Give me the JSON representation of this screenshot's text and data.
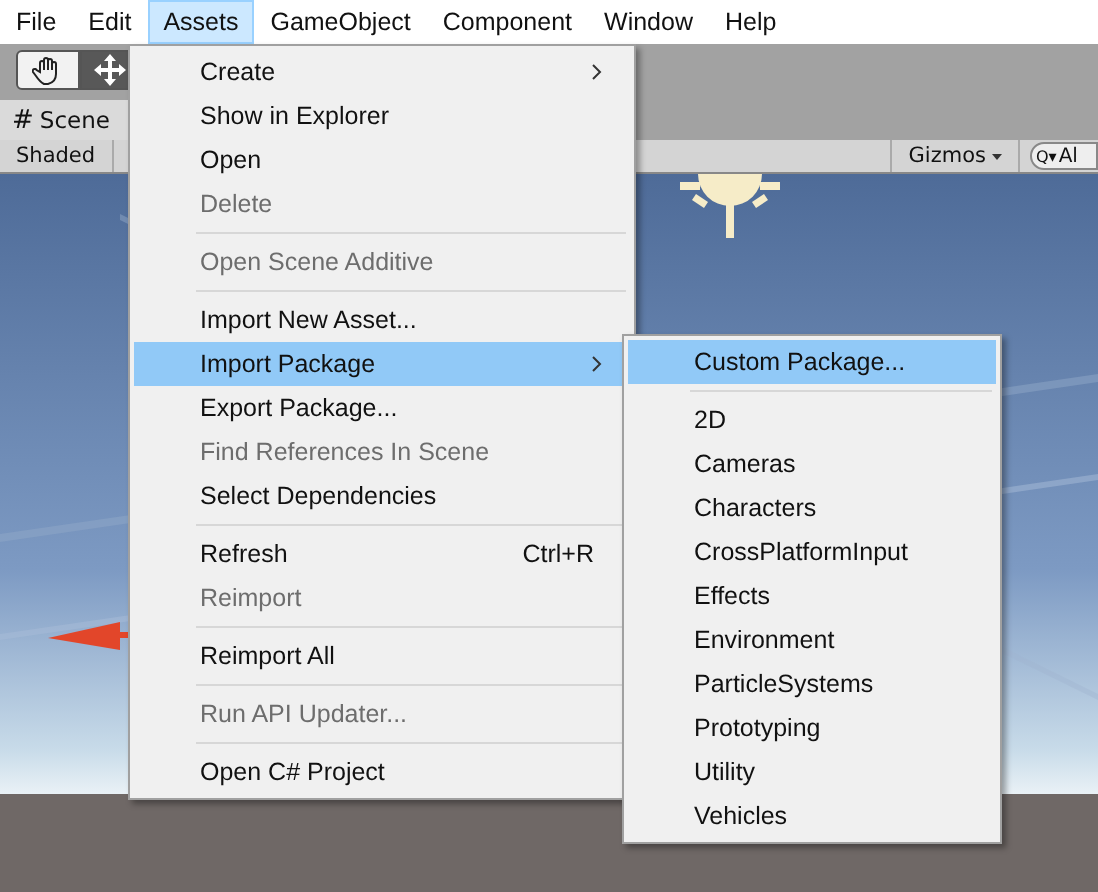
{
  "menu_bar": [
    {
      "label": "File",
      "selected": false
    },
    {
      "label": "Edit",
      "selected": false
    },
    {
      "label": "Assets",
      "selected": true
    },
    {
      "label": "GameObject",
      "selected": false
    },
    {
      "label": "Component",
      "selected": false
    },
    {
      "label": "Window",
      "selected": false
    },
    {
      "label": "Help",
      "selected": false
    }
  ],
  "toolbar": {
    "tools": [
      {
        "kind": "hand",
        "selected": true
      },
      {
        "kind": "move",
        "selected": false
      }
    ]
  },
  "scene_tab": {
    "icon": "#",
    "label": "Scene"
  },
  "scene_bar": {
    "draw_mode": "Shaded",
    "gizmos": "Gizmos",
    "search_icon": "Q▾",
    "search_placeholder": "Al"
  },
  "assets_menu": {
    "items": [
      {
        "kind": "item",
        "label": "Create",
        "disabled": false,
        "selected": false,
        "submenu": true
      },
      {
        "kind": "item",
        "label": "Show in Explorer",
        "disabled": false,
        "selected": false
      },
      {
        "kind": "item",
        "label": "Open",
        "disabled": false,
        "selected": false
      },
      {
        "kind": "item",
        "label": "Delete",
        "disabled": true,
        "selected": false
      },
      {
        "kind": "separator"
      },
      {
        "kind": "item",
        "label": "Open Scene Additive",
        "disabled": true,
        "selected": false
      },
      {
        "kind": "separator"
      },
      {
        "kind": "item",
        "label": "Import New Asset...",
        "disabled": false,
        "selected": false
      },
      {
        "kind": "item",
        "label": "Import Package",
        "disabled": false,
        "selected": true,
        "submenu": true
      },
      {
        "kind": "item",
        "label": "Export Package...",
        "disabled": false,
        "selected": false
      },
      {
        "kind": "item",
        "label": "Find References In Scene",
        "disabled": true,
        "selected": false
      },
      {
        "kind": "item",
        "label": "Select Dependencies",
        "disabled": false,
        "selected": false
      },
      {
        "kind": "separator"
      },
      {
        "kind": "item",
        "label": "Refresh",
        "disabled": false,
        "selected": false,
        "shortcut": "Ctrl+R"
      },
      {
        "kind": "item",
        "label": "Reimport",
        "disabled": true,
        "selected": false
      },
      {
        "kind": "separator"
      },
      {
        "kind": "item",
        "label": "Reimport All",
        "disabled": false,
        "selected": false
      },
      {
        "kind": "separator"
      },
      {
        "kind": "item",
        "label": "Run API Updater...",
        "disabled": true,
        "selected": false
      },
      {
        "kind": "separator"
      },
      {
        "kind": "item",
        "label": "Open C# Project",
        "disabled": false,
        "selected": false
      }
    ]
  },
  "import_package_submenu": {
    "items": [
      {
        "kind": "item",
        "label": "Custom Package...",
        "disabled": false,
        "selected": true
      },
      {
        "kind": "separator"
      },
      {
        "kind": "item",
        "label": "2D",
        "disabled": false,
        "selected": false
      },
      {
        "kind": "item",
        "label": "Cameras",
        "disabled": false,
        "selected": false
      },
      {
        "kind": "item",
        "label": "Characters",
        "disabled": false,
        "selected": false
      },
      {
        "kind": "item",
        "label": "CrossPlatformInput",
        "disabled": false,
        "selected": false
      },
      {
        "kind": "item",
        "label": "Effects",
        "disabled": false,
        "selected": false
      },
      {
        "kind": "item",
        "label": "Environment",
        "disabled": false,
        "selected": false
      },
      {
        "kind": "item",
        "label": "ParticleSystems",
        "disabled": false,
        "selected": false
      },
      {
        "kind": "item",
        "label": "Prototyping",
        "disabled": false,
        "selected": false
      },
      {
        "kind": "item",
        "label": "Utility",
        "disabled": false,
        "selected": false
      },
      {
        "kind": "item",
        "label": "Vehicles",
        "disabled": false,
        "selected": false
      }
    ]
  }
}
